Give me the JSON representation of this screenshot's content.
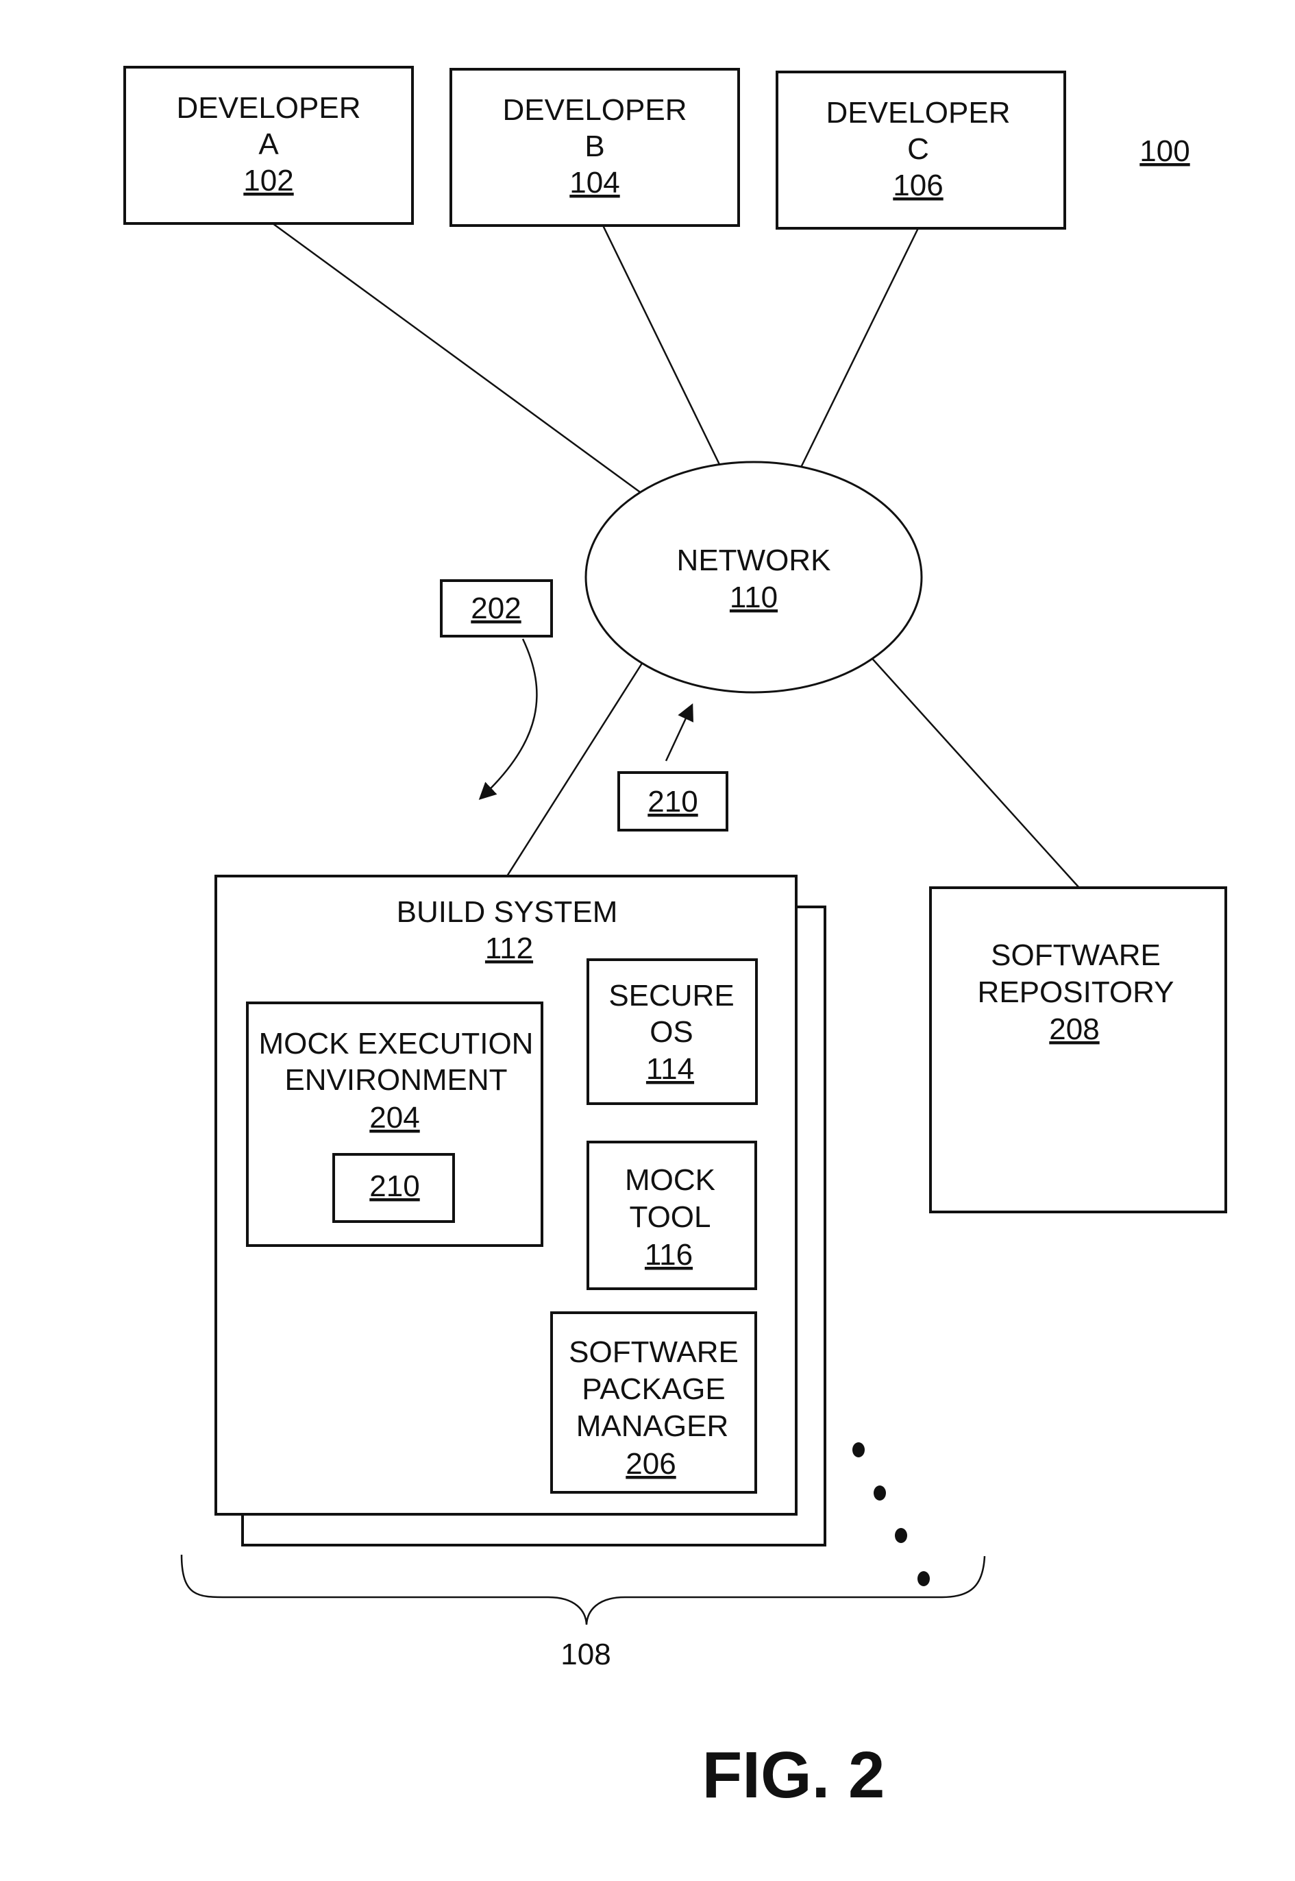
{
  "figure": {
    "reference": "100",
    "caption": "FIG. 2"
  },
  "developers": [
    {
      "line1": "DEVELOPER",
      "line2": "A",
      "ref": "102"
    },
    {
      "line1": "DEVELOPER",
      "line2": "B",
      "ref": "104"
    },
    {
      "line1": "DEVELOPER",
      "line2": "C",
      "ref": "106"
    }
  ],
  "network": {
    "label": "NETWORK",
    "ref": "110"
  },
  "floating_boxes": {
    "box_202": "202",
    "box_210": "210"
  },
  "build_system": {
    "label": "BUILD SYSTEM",
    "ref": "112",
    "group_ref": "108",
    "mock_execution_environment": {
      "line1": "MOCK EXECUTION",
      "line2": "ENVIRONMENT",
      "ref": "204",
      "inner_ref": "210"
    },
    "secure_os": {
      "line1": "SECURE",
      "line2": "OS",
      "ref": "114"
    },
    "mock_tool": {
      "line1": "MOCK",
      "line2": "TOOL",
      "ref": "116"
    },
    "software_package_manager": {
      "line1": "SOFTWARE",
      "line2": "PACKAGE",
      "line3": "MANAGER",
      "ref": "206"
    }
  },
  "software_repository": {
    "line1": "SOFTWARE",
    "line2": "REPOSITORY",
    "ref": "208"
  }
}
